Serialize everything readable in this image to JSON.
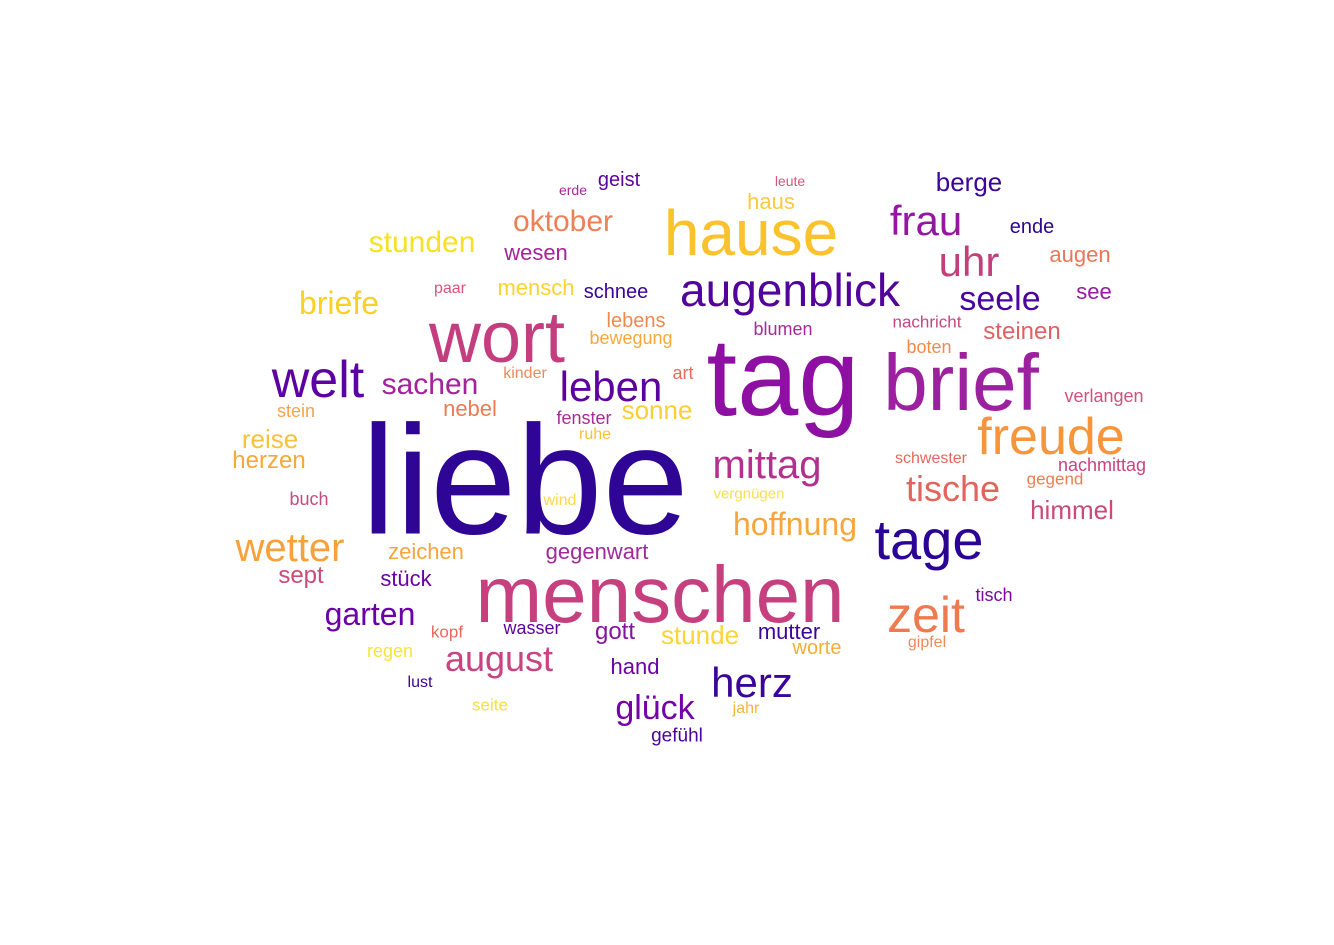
{
  "words": [
    {
      "text": "liebe",
      "color": "#2f0596"
    },
    {
      "text": "tag",
      "color": "#8e10a2"
    },
    {
      "text": "menschen",
      "color": "#c63f7e"
    },
    {
      "text": "brief",
      "color": "#9c219e"
    },
    {
      "text": "wort",
      "color": "#c43e7f"
    },
    {
      "text": "hause",
      "color": "#fbc22d"
    },
    {
      "text": "tage",
      "color": "#2c0495"
    },
    {
      "text": "augenblick",
      "color": "#52039c"
    },
    {
      "text": "freude",
      "color": "#f6963c"
    },
    {
      "text": "welt",
      "color": "#5c02a3"
    },
    {
      "text": "zeit",
      "color": "#ee7a4f"
    },
    {
      "text": "leben",
      "color": "#5c039f"
    },
    {
      "text": "mittag",
      "color": "#b2318e"
    },
    {
      "text": "herz",
      "color": "#3b049a"
    },
    {
      "text": "wetter",
      "color": "#f8a03a"
    },
    {
      "text": "frau",
      "color": "#93189f"
    },
    {
      "text": "august",
      "color": "#c74480"
    },
    {
      "text": "uhr",
      "color": "#c1407c"
    },
    {
      "text": "tische",
      "color": "#e2645c"
    },
    {
      "text": "seele",
      "color": "#4b049d"
    },
    {
      "text": "hoffnung",
      "color": "#f7a63b"
    },
    {
      "text": "glück",
      "color": "#7303a6"
    },
    {
      "text": "oktober",
      "color": "#ed8055"
    },
    {
      "text": "garten",
      "color": "#6a00a8"
    },
    {
      "text": "sachen",
      "color": "#a3219b"
    },
    {
      "text": "briefe",
      "color": "#fbd025"
    },
    {
      "text": "stunden",
      "color": "#f8e025"
    },
    {
      "text": "himmel",
      "color": "#c94b79"
    },
    {
      "text": "sonne",
      "color": "#fbcf35"
    },
    {
      "text": "berge",
      "color": "#3b049a"
    },
    {
      "text": "stunde",
      "color": "#fbd435"
    },
    {
      "text": "gott",
      "color": "#8612a0"
    },
    {
      "text": "mutter",
      "color": "#3c049b"
    },
    {
      "text": "reise",
      "color": "#f8c13b"
    },
    {
      "text": "herzen",
      "color": "#f6a83a"
    },
    {
      "text": "sept",
      "color": "#cb4a78"
    },
    {
      "text": "zeichen",
      "color": "#f6a63b"
    },
    {
      "text": "gegenwart",
      "color": "#a22a98"
    },
    {
      "text": "steinen",
      "color": "#de6262"
    },
    {
      "text": "nebel",
      "color": "#ec7a52"
    },
    {
      "text": "augen",
      "color": "#ea7657"
    },
    {
      "text": "hand",
      "color": "#6e02a6"
    },
    {
      "text": "wesen",
      "color": "#a3239b"
    },
    {
      "text": "mensch",
      "color": "#fbd42e"
    },
    {
      "text": "stück",
      "color": "#6b02a6"
    },
    {
      "text": "see",
      "color": "#931d9c"
    },
    {
      "text": "ende",
      "color": "#2c0594"
    },
    {
      "text": "haus",
      "color": "#fbc940"
    },
    {
      "text": "geist",
      "color": "#5c039f"
    },
    {
      "text": "schnee",
      "color": "#3a049a"
    },
    {
      "text": "worte",
      "color": "#f8ac37"
    },
    {
      "text": "lebens",
      "color": "#ef8a4f"
    },
    {
      "text": "bewegung",
      "color": "#f7a73c"
    },
    {
      "text": "blumen",
      "color": "#a52a98"
    },
    {
      "text": "fenster",
      "color": "#a92a96"
    },
    {
      "text": "boten",
      "color": "#ef8a4f"
    },
    {
      "text": "stein",
      "color": "#f6a24a"
    },
    {
      "text": "gefühl",
      "color": "#4b049d"
    },
    {
      "text": "wasser",
      "color": "#5c039f"
    },
    {
      "text": "verlangen",
      "color": "#d0527a"
    },
    {
      "text": "nachmittag",
      "color": "#c74480"
    },
    {
      "text": "nachricht",
      "color": "#c44682"
    },
    {
      "text": "tisch",
      "color": "#7e05a4"
    },
    {
      "text": "buch",
      "color": "#c74a80"
    },
    {
      "text": "art",
      "color": "#e76b5c"
    },
    {
      "text": "gegend",
      "color": "#ef7e4f"
    },
    {
      "text": "kopf",
      "color": "#e66a5c"
    },
    {
      "text": "schwester",
      "color": "#e3675e"
    },
    {
      "text": "paar",
      "color": "#d6567a"
    },
    {
      "text": "regen",
      "color": "#f7e53a"
    },
    {
      "text": "kinder",
      "color": "#ee8a5c"
    },
    {
      "text": "ruhe",
      "color": "#f8c13b"
    },
    {
      "text": "gipfel",
      "color": "#f08a55"
    },
    {
      "text": "lust",
      "color": "#3c0493"
    },
    {
      "text": "seite",
      "color": "#f8e03a"
    },
    {
      "text": "jahr",
      "color": "#f8b43a"
    },
    {
      "text": "wind",
      "color": "#fbd84a"
    },
    {
      "text": "vergnügen",
      "color": "#f8e04a"
    },
    {
      "text": "erde",
      "color": "#a2299a"
    },
    {
      "text": "leute",
      "color": "#d6567a"
    }
  ]
}
